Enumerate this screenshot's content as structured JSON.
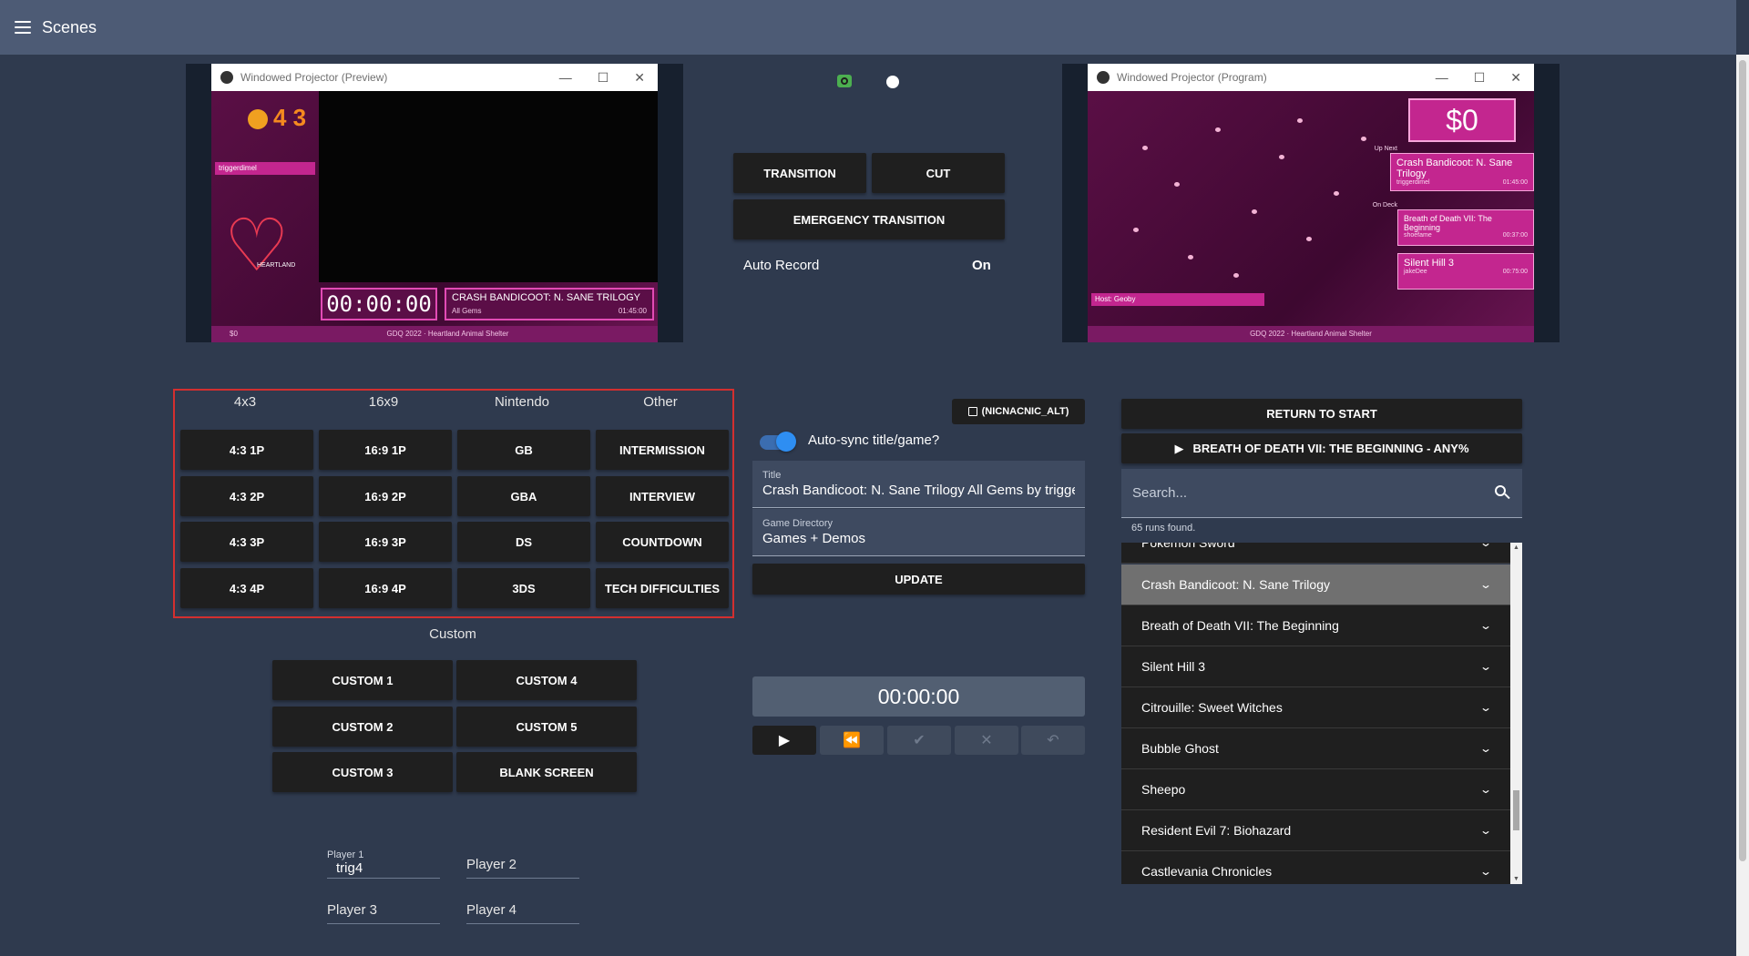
{
  "header": {
    "title": "Scenes"
  },
  "preview": {
    "window_title": "Windowed Projector (Preview)",
    "gem_count": "4 3",
    "runner": "triggerdimel",
    "timer": "00:00:00",
    "game_title": "CRASH BANDICOOT: N. SANE TRILOGY",
    "game_sub": "All Gems",
    "estimate": "01:45:00",
    "heart_label": "HEARTLAND",
    "money": "$0",
    "footer": "GDQ 2022 · Heartland Animal Shelter"
  },
  "program": {
    "window_title": "Windowed Projector (Program)",
    "money": "$0",
    "up_next_label": "Up Next",
    "up_next_game": "Crash Bandicoot: N. Sane Trilogy",
    "up_next_runner": "triggerdimel",
    "up_next_est": "01:45:00",
    "on_deck_label": "On Deck",
    "on_deck_game": "Breath of Death VII: The Beginning",
    "on_deck_runner": "shoefame",
    "on_deck_est": "00:37:00",
    "third_game": "Silent Hill 3",
    "third_runner": "jakeDee",
    "third_est": "00:75:00",
    "host": "Host: Geoby",
    "footer": "GDQ 2022 · Heartland Animal Shelter"
  },
  "transition": {
    "transition_label": "TRANSITION",
    "cut_label": "CUT",
    "emergency_label": "EMERGENCY TRANSITION",
    "auto_record_label": "Auto Record",
    "auto_record_value": "On"
  },
  "scenes": {
    "columns": [
      "4x3",
      "16x9",
      "Nintendo",
      "Other"
    ],
    "col_4x3": [
      "4:3 1P",
      "4:3 2P",
      "4:3 3P",
      "4:3 4P"
    ],
    "col_16x9": [
      "16:9 1P",
      "16:9 2P",
      "16:9 3P",
      "16:9 4P"
    ],
    "col_nintendo": [
      "GB",
      "GBA",
      "DS",
      "3DS"
    ],
    "col_other": [
      "INTERMISSION",
      "INTERVIEW",
      "COUNTDOWN",
      "TECH DIFFICULTIES"
    ],
    "custom_label": "Custom",
    "custom_left": [
      "CUSTOM 1",
      "CUSTOM 2",
      "CUSTOM 3"
    ],
    "custom_right": [
      "CUSTOM 4",
      "CUSTOM 5",
      "BLANK SCREEN"
    ]
  },
  "players": {
    "p1_label": "Player 1",
    "p1_value": "trig4",
    "p2_placeholder": "Player 2",
    "p3_placeholder": "Player 3",
    "p4_placeholder": "Player 4"
  },
  "twitch": {
    "account_button": "(NICNACNIC_ALT)",
    "autosync_label": "Auto-sync title/game?",
    "autosync_on": true,
    "title_label": "Title",
    "title_value": "Crash Bandicoot: N. Sane Trilogy All Gems by trigge",
    "game_label": "Game Directory",
    "game_value": "Games + Demos",
    "update_label": "UPDATE"
  },
  "timer": {
    "value": "00:00:00"
  },
  "runs": {
    "return_label": "RETURN TO START",
    "next_run_label": "BREATH OF DEATH VII: THE BEGINNING - ANY%",
    "search_placeholder": "Search...",
    "count_text": "65 runs found.",
    "items": [
      "Pokemon Sword",
      "Crash Bandicoot: N. Sane Trilogy",
      "Breath of Death VII: The Beginning",
      "Silent Hill 3",
      "Citrouille: Sweet Witches",
      "Bubble Ghost",
      "Sheepo",
      "Resident Evil 7: Biohazard",
      "Castlevania Chronicles"
    ],
    "selected_index": 1
  },
  "colors": {
    "background": "#2f3a4e",
    "topbar": "#4d5b75",
    "button": "#1f1f1f",
    "highlight_border": "#d32f2f",
    "toggle": "#2e8ef2",
    "overlay_pink": "#c3268f"
  }
}
